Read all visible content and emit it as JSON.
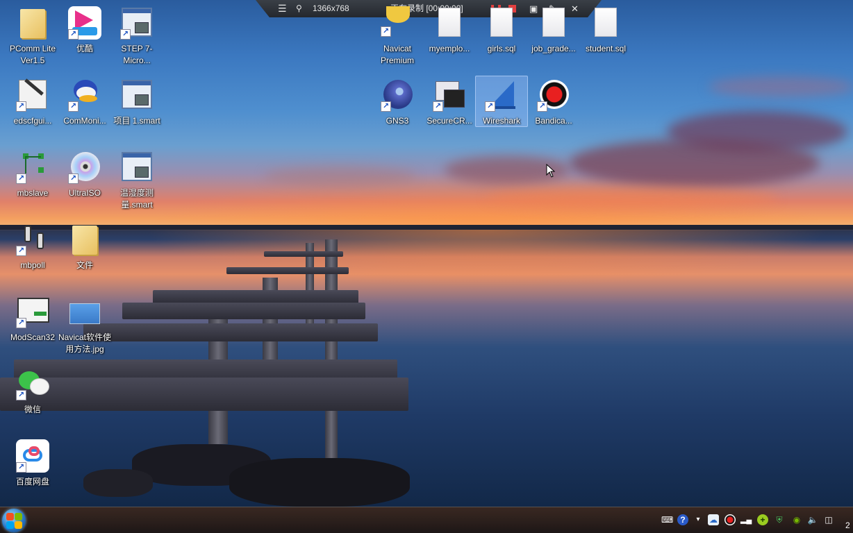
{
  "recorder": {
    "resolution": "1366x768",
    "status": "正在录制 [00:00:00]",
    "menu_icon": "menu-icon",
    "pin_icon": "pin-icon",
    "pause_icon": "pause-icon",
    "stop_icon": "stop-icon",
    "camera_icon": "camera-icon",
    "pencil_icon": "pencil-icon",
    "close_icon": "close-icon"
  },
  "desktop": {
    "icons": [
      {
        "label": "PComm Lite Ver1.5",
        "icon": "folder-icon"
      },
      {
        "label": "优酷",
        "icon": "youku-icon"
      },
      {
        "label": "STEP 7-Micro...",
        "icon": "step7-icon"
      },
      {
        "label": "edscfgui...",
        "icon": "tools-icon"
      },
      {
        "label": "ComMoni...",
        "icon": "duck-icon"
      },
      {
        "label": "项目 1.smart",
        "icon": "step7-icon"
      },
      {
        "label": "mbslave",
        "icon": "network-icon"
      },
      {
        "label": "UltraISO",
        "icon": "disc-icon"
      },
      {
        "label": "温湿度测量.smart",
        "icon": "step7-icon"
      },
      {
        "label": "mbpoll",
        "icon": "plug-icon"
      },
      {
        "label": "文件",
        "icon": "folder-icon"
      },
      {
        "label": "ModScan32",
        "icon": "modscan-icon"
      },
      {
        "label": "Navicat软件使用方法.jpg",
        "icon": "image-icon"
      },
      {
        "label": "微信",
        "icon": "wechat-icon"
      },
      {
        "label": "百度网盘",
        "icon": "baidu-cloud-icon"
      },
      {
        "label": "Navicat Premium",
        "icon": "navicat-icon"
      },
      {
        "label": "myemplo...",
        "icon": "document-icon"
      },
      {
        "label": "girls.sql",
        "icon": "document-icon"
      },
      {
        "label": "job_grade...",
        "icon": "document-icon"
      },
      {
        "label": "student.sql",
        "icon": "document-icon"
      },
      {
        "label": "GNS3",
        "icon": "chameleon-icon"
      },
      {
        "label": "SecureCR...",
        "icon": "terminal-icon"
      },
      {
        "label": "Wireshark",
        "icon": "shark-fin-icon"
      },
      {
        "label": "Bandica...",
        "icon": "record-icon"
      }
    ]
  },
  "taskbar": {
    "start_icon": "windows-start-icon",
    "clock_partial": "2",
    "tray_icons": [
      "keyboard-icon",
      "help-icon",
      "chevron-icon",
      "cloud-sync-icon",
      "record-icon",
      "signal-icon",
      "plus-icon",
      "shield-icon",
      "nvidia-icon",
      "volume-icon",
      "battery-icon"
    ]
  }
}
